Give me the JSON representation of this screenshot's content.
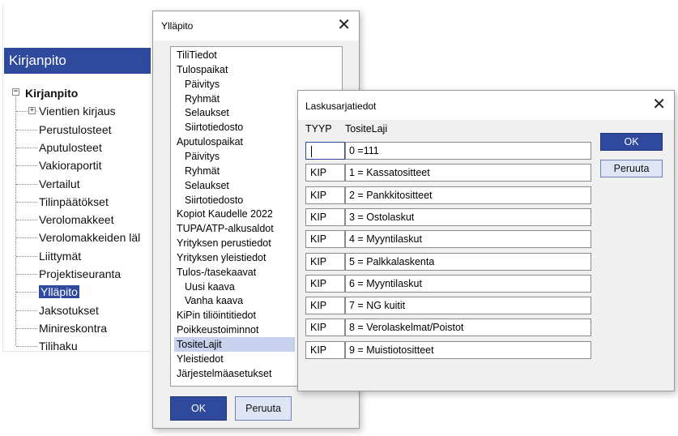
{
  "sidebar": {
    "header": "Kirjanpito",
    "root": "Kirjanpito",
    "items": [
      {
        "label": "Vientien kirjaus",
        "expander": true
      },
      {
        "label": "Perustulosteet"
      },
      {
        "label": "Aputulosteet"
      },
      {
        "label": "Vakioraportit"
      },
      {
        "label": "Vertailut"
      },
      {
        "label": "Tilinpäätökset"
      },
      {
        "label": "Verolomakkeet"
      },
      {
        "label": "Verolomakkeiden läl"
      },
      {
        "label": "Liittymät"
      },
      {
        "label": "Projektiseuranta"
      },
      {
        "label": "Ylläpito",
        "selected": true
      },
      {
        "label": "Jaksotukset"
      },
      {
        "label": "Minireskontra"
      },
      {
        "label": "Tilihaku"
      }
    ]
  },
  "yllapito_dialog": {
    "title": "Ylläpito",
    "close_glyph": "✕",
    "items": [
      {
        "label": "TiliTiedot",
        "indent": false
      },
      {
        "label": "Tulospaikat",
        "indent": false
      },
      {
        "label": "Päivitys",
        "indent": true
      },
      {
        "label": "Ryhmät",
        "indent": true
      },
      {
        "label": "Selaukset",
        "indent": true
      },
      {
        "label": "Siirtotiedosto",
        "indent": true
      },
      {
        "label": "Aputulospaikat",
        "indent": false
      },
      {
        "label": "Päivitys",
        "indent": true
      },
      {
        "label": "Ryhmät",
        "indent": true
      },
      {
        "label": "Selaukset",
        "indent": true
      },
      {
        "label": "Siirtotiedosto",
        "indent": true
      },
      {
        "label": "Kopiot Kaudelle 2022",
        "indent": false
      },
      {
        "label": "TUPA/ATP-alkusaldot",
        "indent": false
      },
      {
        "label": "Yrityksen perustiedot",
        "indent": false
      },
      {
        "label": "Yrityksen yleistiedot",
        "indent": false
      },
      {
        "label": "Tulos-/tasekaavat",
        "indent": false
      },
      {
        "label": "Uusi kaava",
        "indent": true
      },
      {
        "label": "Vanha kaava",
        "indent": true
      },
      {
        "label": "KiPin tiliöintitiedot",
        "indent": false
      },
      {
        "label": "Poikkeustoiminnot",
        "indent": false
      },
      {
        "label": "TositeLajit",
        "indent": false,
        "selected": true
      },
      {
        "label": "Yleistiedot",
        "indent": false
      },
      {
        "label": "Järjestelmäasetukset",
        "indent": false
      }
    ],
    "ok_label": "OK",
    "cancel_label": "Peruuta"
  },
  "laskusarja_dialog": {
    "title": "Laskusarjatiedot",
    "close_glyph": "✕",
    "col_typ": "TYYP",
    "col_laji": "TositeLaji",
    "rows": [
      {
        "typ": "",
        "laji": "0 =111",
        "focused": true
      },
      {
        "typ": "KIP",
        "laji": "1 = Kassatositteet"
      },
      {
        "typ": "KIP",
        "laji": "2 = Pankkitositteet"
      },
      {
        "typ": "KIP",
        "laji": "3 = Ostolaskut"
      },
      {
        "typ": "KIP",
        "laji": "4 = Myyntilaskut"
      },
      {
        "typ": "KIP",
        "laji": "5 = Palkkalaskenta"
      },
      {
        "typ": "KIP",
        "laji": "6 = Myyntilaskut"
      },
      {
        "typ": "KIP",
        "laji": "7 = NG kuitit"
      },
      {
        "typ": "KIP",
        "laji": "8 = Verolaskelmat/Poistot"
      },
      {
        "typ": "KIP",
        "laji": "9 = Muistiotositteet"
      }
    ],
    "ok_label": "OK",
    "cancel_label": "Peruuta"
  },
  "colors": {
    "accent": "#2f4a9c",
    "selection_light": "#c8d2ee",
    "dialog_bg": "#f0f0f0"
  }
}
